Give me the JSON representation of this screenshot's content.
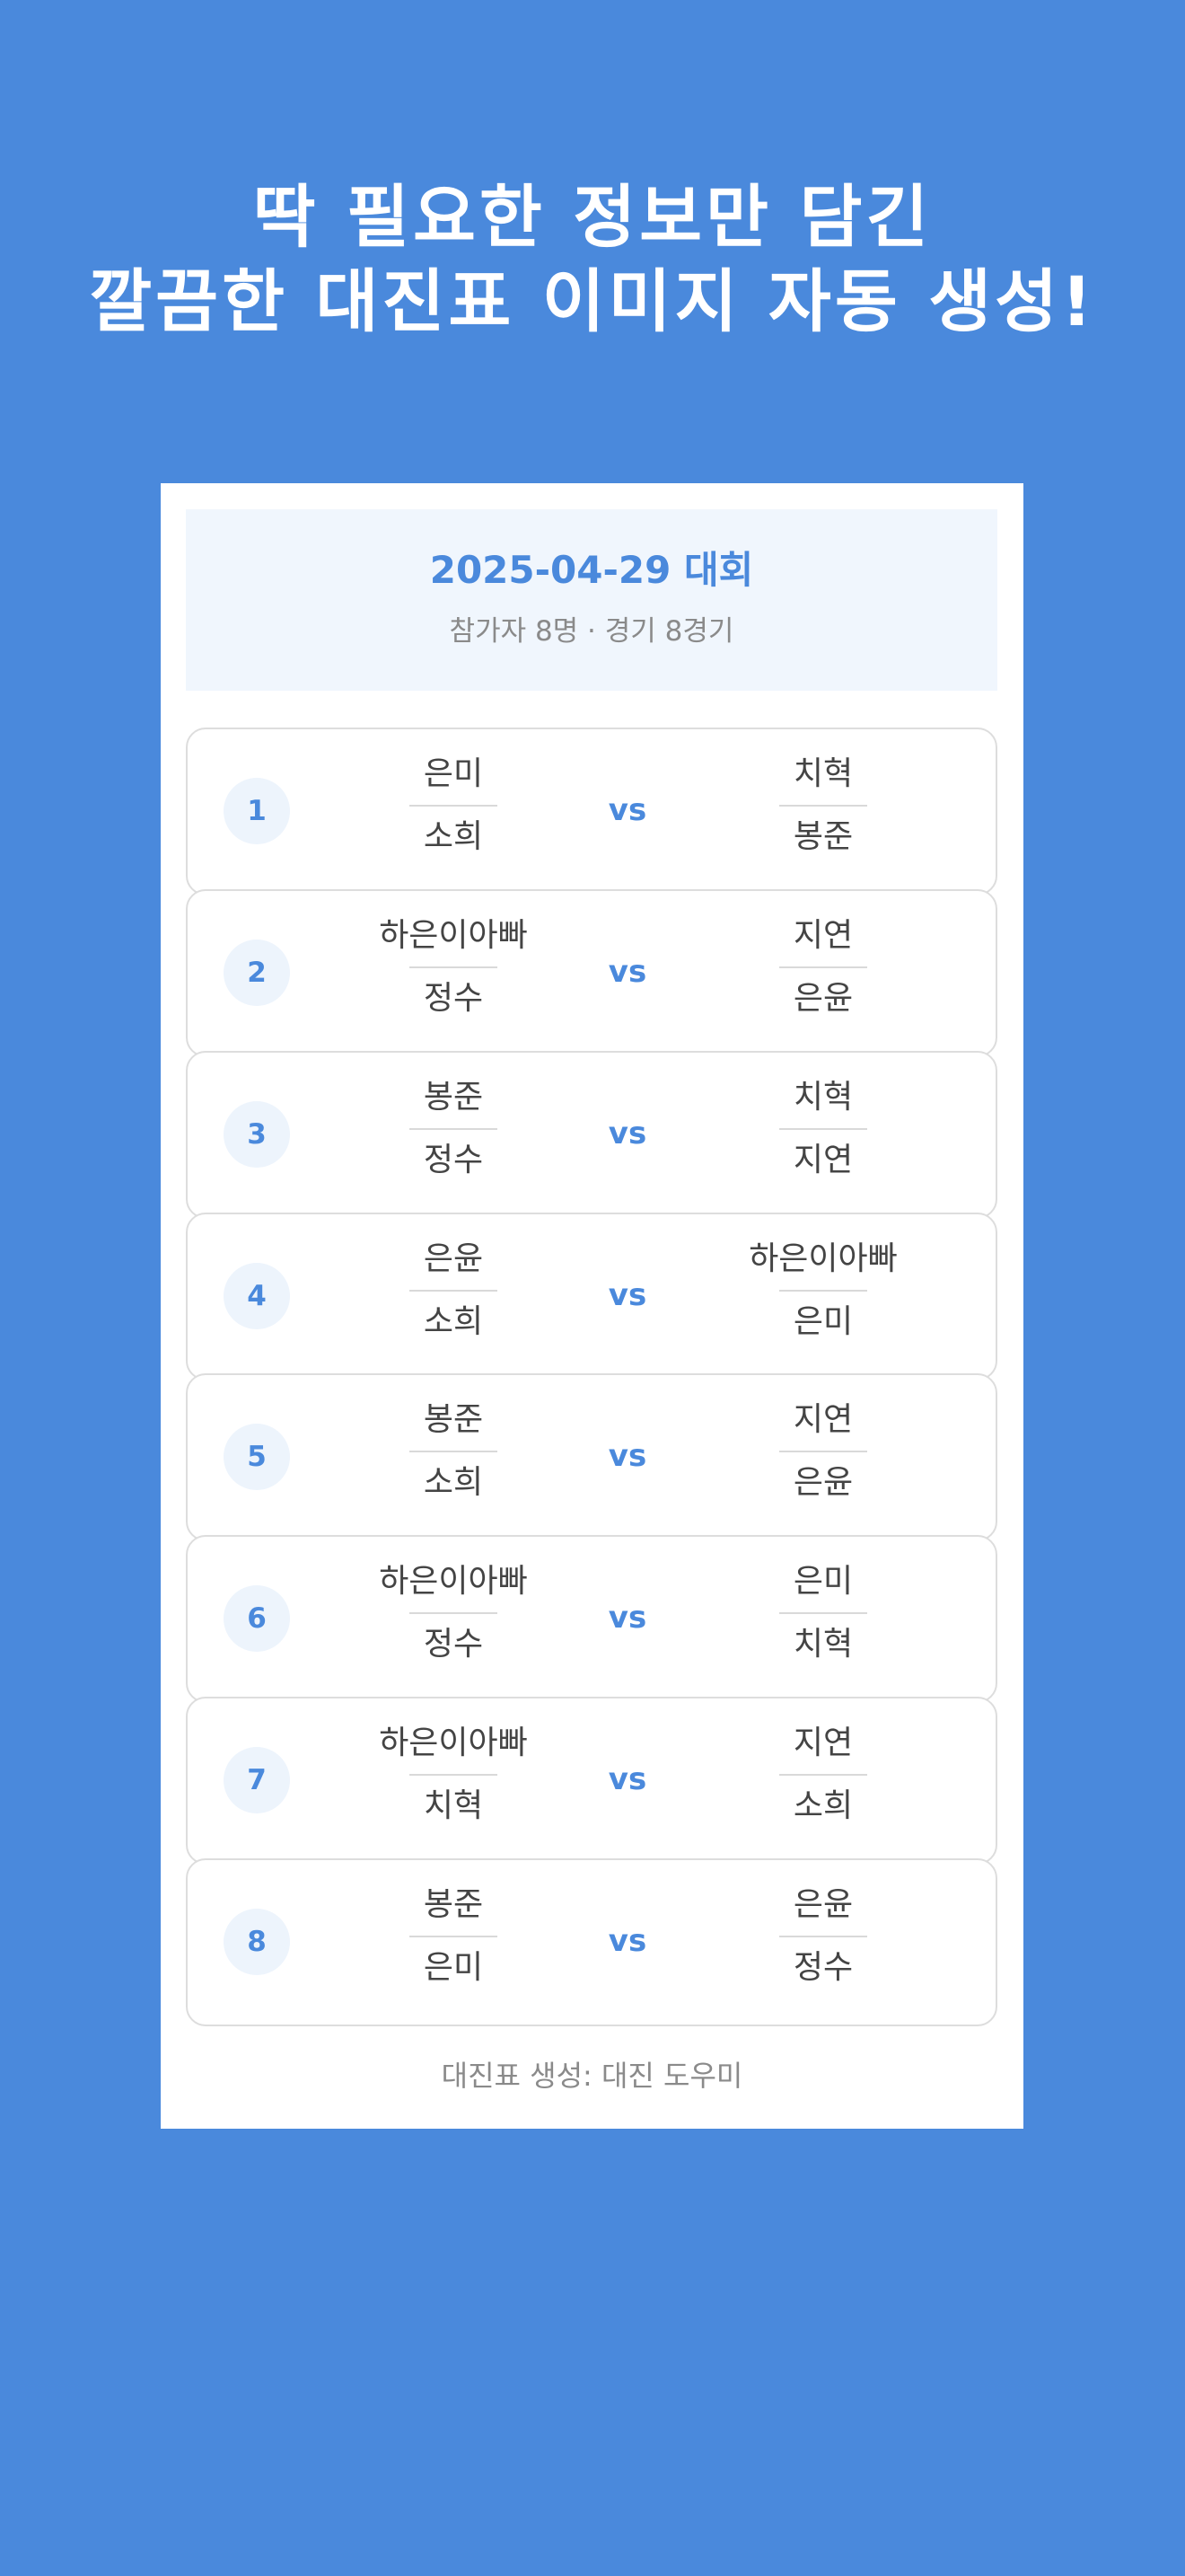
{
  "headline": {
    "line1": "딱 필요한 정보만 담긴",
    "line2": "깔끔한 대진표 이미지 자동 생성!"
  },
  "tournament": {
    "title": "2025-04-29 대회",
    "subtitle": "참가자 8명 · 경기 8경기"
  },
  "vs_label": "vs",
  "matches": [
    {
      "number": "1",
      "left": [
        "은미",
        "소희"
      ],
      "right": [
        "치혁",
        "봉준"
      ]
    },
    {
      "number": "2",
      "left": [
        "하은이아빠",
        "정수"
      ],
      "right": [
        "지연",
        "은윤"
      ]
    },
    {
      "number": "3",
      "left": [
        "봉준",
        "정수"
      ],
      "right": [
        "치혁",
        "지연"
      ]
    },
    {
      "number": "4",
      "left": [
        "은윤",
        "소희"
      ],
      "right": [
        "하은이아빠",
        "은미"
      ]
    },
    {
      "number": "5",
      "left": [
        "봉준",
        "소희"
      ],
      "right": [
        "지연",
        "은윤"
      ]
    },
    {
      "number": "6",
      "left": [
        "하은이아빠",
        "정수"
      ],
      "right": [
        "은미",
        "치혁"
      ]
    },
    {
      "number": "7",
      "left": [
        "하은이아빠",
        "치혁"
      ],
      "right": [
        "지연",
        "소희"
      ]
    },
    {
      "number": "8",
      "left": [
        "봉준",
        "은미"
      ],
      "right": [
        "은윤",
        "정수"
      ]
    }
  ],
  "footer": "대진표 생성: 대진 도우미",
  "colors": {
    "background": "#4a89dc",
    "accent": "#4a89dc",
    "card": "#ffffff",
    "header_bg": "#f0f6fd"
  }
}
